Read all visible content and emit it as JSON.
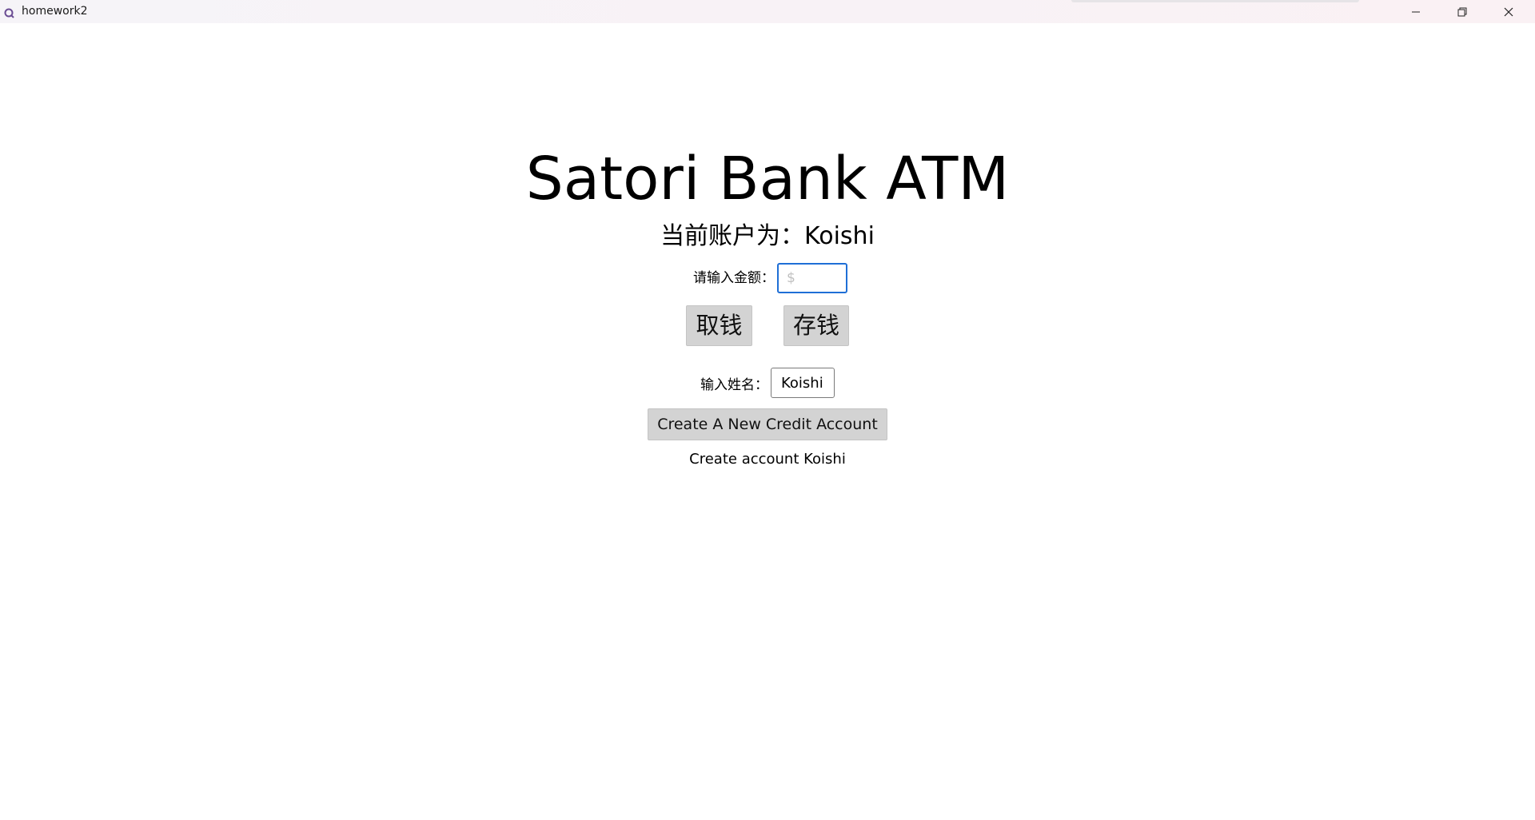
{
  "window": {
    "title": "homework2",
    "icon": "app-icon",
    "controls": {
      "minimize_icon": "minimize-icon",
      "maximize_icon": "restore-icon",
      "close_icon": "close-icon"
    }
  },
  "main": {
    "title": "Satori Bank ATM",
    "account_line": "当前账户为：Koishi",
    "amount": {
      "label": "请输入金额：",
      "value": "",
      "placeholder": "$"
    },
    "buttons": {
      "withdraw_label": "取钱",
      "deposit_label": "存钱"
    },
    "name": {
      "label": "输入姓名：",
      "value": "Koishi"
    },
    "create_button_label": "Create A New Credit Account",
    "status": "Create account Koishi"
  },
  "colors": {
    "focus_border": "#1f6fd6",
    "button_bg": "#d3d3d3",
    "background": "#ffffff"
  }
}
